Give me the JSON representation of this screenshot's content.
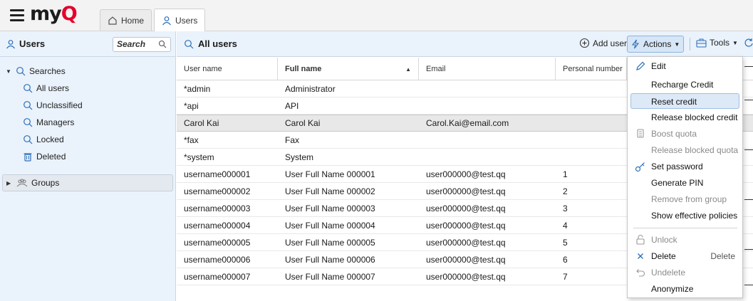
{
  "header": {
    "logo_text": "my",
    "logo_accent": "Q",
    "tabs": [
      {
        "label": "Home",
        "icon": "home-icon"
      },
      {
        "label": "Users",
        "icon": "user-icon"
      }
    ]
  },
  "sidebar": {
    "title": "Users",
    "search_label": "Search",
    "searches_label": "Searches",
    "searches": [
      {
        "label": "All users",
        "icon": "search-icon"
      },
      {
        "label": "Unclassified",
        "icon": "search-icon"
      },
      {
        "label": "Managers",
        "icon": "search-icon"
      },
      {
        "label": "Locked",
        "icon": "search-icon"
      },
      {
        "label": "Deleted",
        "icon": "trash-icon"
      }
    ],
    "groups_label": "Groups"
  },
  "toolbar": {
    "title": "All users",
    "add_user": "Add user",
    "actions": "Actions",
    "tools": "Tools"
  },
  "table": {
    "columns": [
      "User name",
      "Full name",
      "Email",
      "Personal number"
    ],
    "rows": [
      {
        "username": "*admin",
        "fullname": "Administrator",
        "email": "",
        "number": ""
      },
      {
        "username": "*api",
        "fullname": "API",
        "email": "",
        "number": ""
      },
      {
        "username": "Carol Kai",
        "fullname": "Carol Kai",
        "email": "Carol.Kai@email.com",
        "number": ""
      },
      {
        "username": "*fax",
        "fullname": "Fax",
        "email": "",
        "number": ""
      },
      {
        "username": "*system",
        "fullname": "System",
        "email": "",
        "number": ""
      },
      {
        "username": "username000001",
        "fullname": "User Full Name 000001",
        "email": "user000000@test.qq",
        "number": "1"
      },
      {
        "username": "username000002",
        "fullname": "User Full Name 000002",
        "email": "user000000@test.qq",
        "number": "2"
      },
      {
        "username": "username000003",
        "fullname": "User Full Name 000003",
        "email": "user000000@test.qq",
        "number": "3"
      },
      {
        "username": "username000004",
        "fullname": "User Full Name 000004",
        "email": "user000000@test.qq",
        "number": "4"
      },
      {
        "username": "username000005",
        "fullname": "User Full Name 000005",
        "email": "user000000@test.qq",
        "number": "5"
      },
      {
        "username": "username000006",
        "fullname": "User Full Name 000006",
        "email": "user000000@test.qq",
        "number": "6"
      },
      {
        "username": "username000007",
        "fullname": "User Full Name 000007",
        "email": "user000000@test.qq",
        "number": "7"
      }
    ]
  },
  "actions_menu": {
    "edit": "Edit",
    "recharge_credit": "Recharge Credit",
    "reset_credit": "Reset credit",
    "release_blocked_credit": "Release blocked credit",
    "boost_quota": "Boost quota",
    "release_blocked_quota": "Release blocked quota",
    "set_password": "Set password",
    "generate_pin": "Generate PIN",
    "remove_from_group": "Remove from group",
    "show_effective_policies": "Show effective policies",
    "unlock": "Unlock",
    "delete": "Delete",
    "delete_shortcut": "Delete",
    "undelete": "Undelete",
    "anonymize": "Anonymize"
  },
  "colors": {
    "accent": "#e4002b",
    "panel_bg": "#eaf2fb",
    "highlight": "#dde9f7"
  }
}
